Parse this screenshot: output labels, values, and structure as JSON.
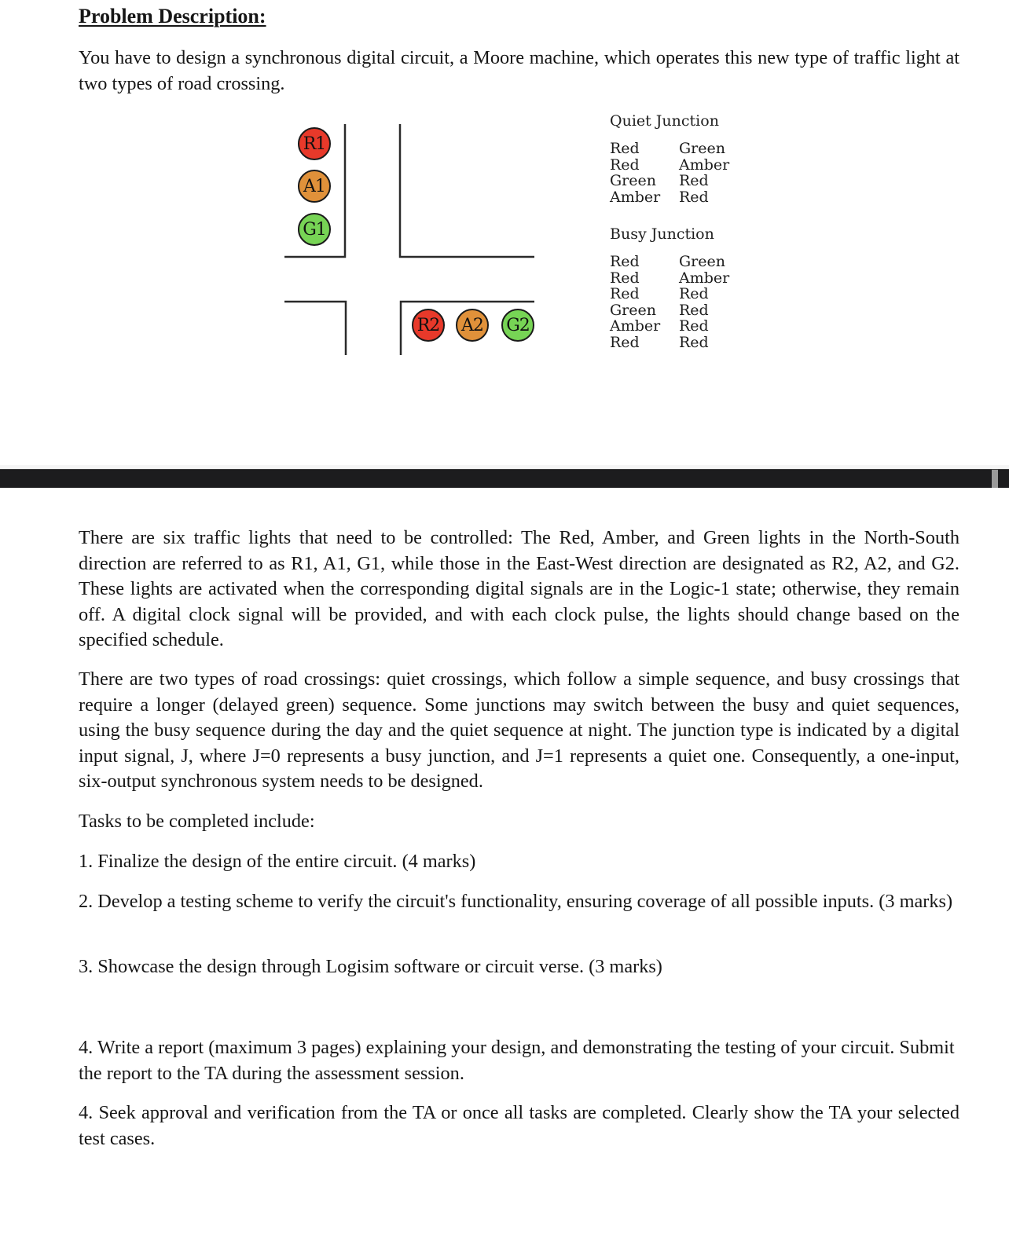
{
  "heading": "Problem Description:",
  "intro": "You have to design a synchronous digital circuit, a Moore machine, which operates this new type of traffic light at two types of road crossing.",
  "diagram": {
    "north_south_lights": [
      {
        "label": "R1",
        "color": "#e8392a"
      },
      {
        "label": "A1",
        "color": "#e0913a"
      },
      {
        "label": "G1",
        "color": "#77d455"
      }
    ],
    "east_west_lights": [
      {
        "label": "R2",
        "color": "#e8392a"
      },
      {
        "label": "A2",
        "color": "#e0913a"
      },
      {
        "label": "G2",
        "color": "#77d455"
      }
    ]
  },
  "quiet_junction": {
    "title": "Quiet Junction",
    "rows": [
      [
        "Red",
        "Green"
      ],
      [
        "Red",
        "Amber"
      ],
      [
        "Green",
        "Red"
      ],
      [
        "Amber",
        "Red"
      ]
    ]
  },
  "busy_junction": {
    "title": "Busy Junction",
    "rows": [
      [
        "Red",
        "Green"
      ],
      [
        "Red",
        "Amber"
      ],
      [
        "Red",
        "Red"
      ],
      [
        "Green",
        "Red"
      ],
      [
        "Amber",
        "Red"
      ],
      [
        "Red",
        "Red"
      ]
    ]
  },
  "paragraphs": {
    "lights": "There are six traffic lights that need to be controlled: The Red, Amber, and Green lights in the North-South direction are referred to as R1, A1, G1, while those in the East-West direction are designated as R2, A2, and G2. These lights are activated when the corresponding digital signals are in the Logic-1 state; otherwise, they remain off. A digital clock signal will be provided, and with each clock pulse, the lights should change based on the specified schedule.",
    "crossings": "There are two types of road crossings: quiet crossings, which follow a simple sequence, and busy crossings that require a longer (delayed green) sequence. Some junctions may switch between the busy and quiet sequences, using the busy sequence during the day and the quiet sequence at night. The junction type is indicated by a digital input signal, J, where J=0 represents a busy junction, and J=1 represents a quiet one. Consequently, a one-input, six-output synchronous system needs to be designed.",
    "tasks_intro": "Tasks to be completed include:"
  },
  "tasks": [
    "1. Finalize the design of the entire circuit. (4 marks)",
    "2. Develop a testing scheme to verify the circuit's functionality, ensuring coverage of all possible inputs. (3 marks)",
    "3. Showcase the design through Logisim software or circuit verse. (3 marks)",
    "4. Write a report (maximum 3 pages) explaining your design, and demonstrating the testing of your circuit. Submit the report to the TA during the assessment session.",
    "4. Seek approval and verification from the TA or once all tasks are completed. Clearly show the TA your selected test cases."
  ]
}
